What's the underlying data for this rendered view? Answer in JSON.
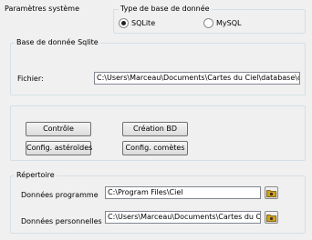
{
  "page_title": "Paramètres système",
  "db_type": {
    "legend": "Type de base de donnée",
    "options": [
      {
        "label": "SQLite",
        "selected": true
      },
      {
        "label": "MySQL",
        "selected": false
      }
    ]
  },
  "sqlite": {
    "legend": "Base de donnée Sqlite",
    "file_label": "Fichier:",
    "file_value": "C:\\Users\\Marceau\\Documents\\Cartes du Ciel\\database\\cdc.db"
  },
  "buttons": {
    "control": "Contrôle",
    "create_db": "Création BD",
    "config_asteroids": "Config. astéroïdes",
    "config_comets": "Config. comètes"
  },
  "directory": {
    "legend": "Répertoire",
    "program_label": "Données programme",
    "program_value": "C:\\Program Files\\Ciel",
    "personal_label": "Données personnelles",
    "personal_value": "C:\\Users\\Marceau\\Documents\\Cartes du Ciel"
  },
  "icons": {
    "folder_button": "folder-icon",
    "accent": "#d4a017"
  }
}
